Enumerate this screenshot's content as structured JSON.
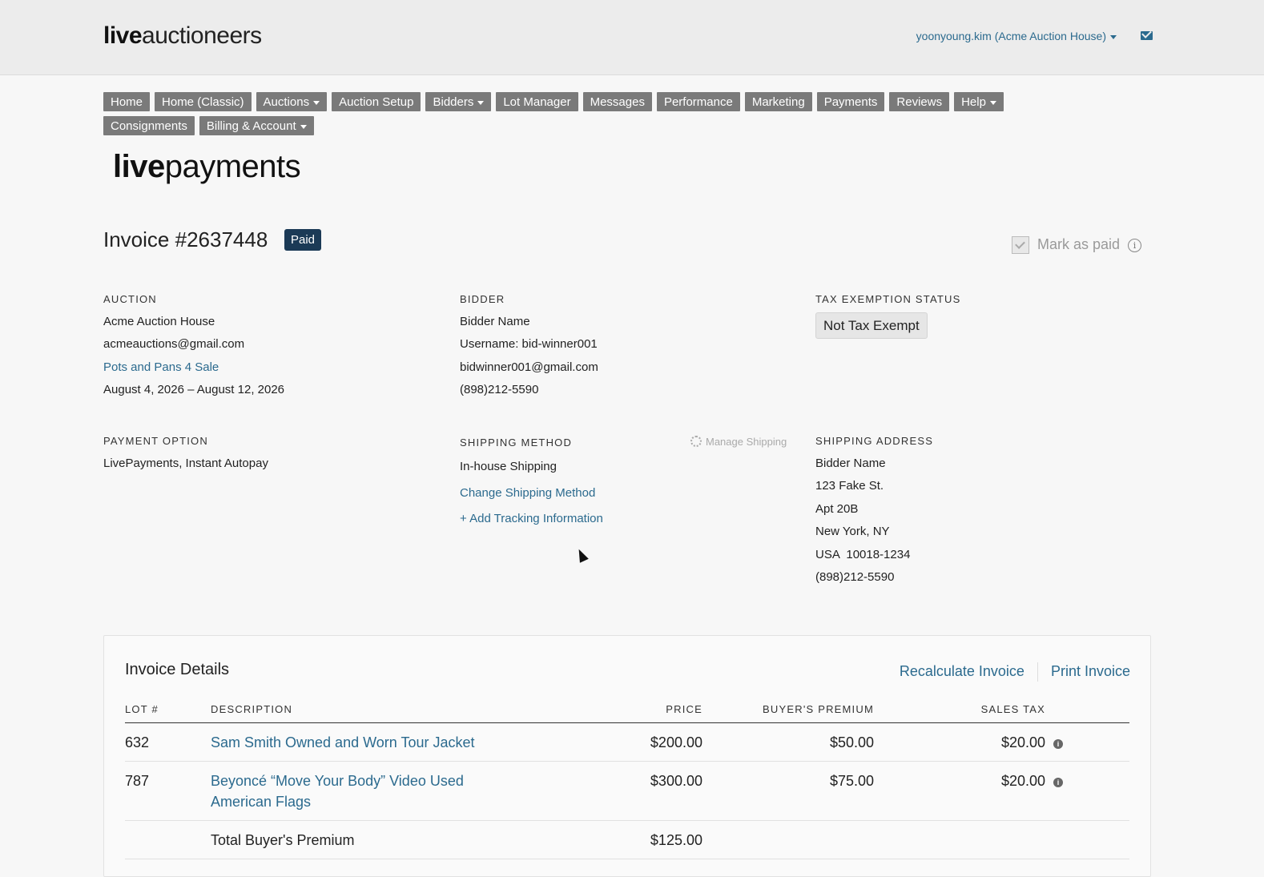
{
  "header": {
    "logo_bold": "live",
    "logo_light": "auctioneers",
    "user_label": "yoonyoung.kim (Acme Auction House)",
    "mail_icon": "envelope-icon"
  },
  "nav": {
    "row1": [
      "Home",
      "Home (Classic)",
      "Auctions",
      "Auction Setup",
      "Bidders",
      "Lot Manager",
      "Messages",
      "Performance",
      "Marketing",
      "Payments",
      "Reviews",
      "Help"
    ],
    "row2": [
      "Consignments",
      "Billing & Account"
    ],
    "dropdowns": [
      "Auctions",
      "Bidders",
      "Help",
      "Billing & Account"
    ]
  },
  "brand": {
    "bold": "live",
    "light": "payments"
  },
  "invoice": {
    "title": "Invoice #2637448",
    "status_badge": "Paid",
    "mark_as_paid": "Mark as paid"
  },
  "auction": {
    "label": "AUCTION",
    "house": "Acme Auction House",
    "email": "acmeauctions@gmail.com",
    "auction_link": "Pots and Pans 4 Sale",
    "dates": "August 4, 2026 – August 12, 2026"
  },
  "bidder": {
    "label": "BIDDER",
    "name": "Bidder Name",
    "username": "Username: bid-winner001",
    "email": "bidwinner001@gmail.com",
    "phone": "(898)212-5590"
  },
  "tax": {
    "label": "TAX EXEMPTION STATUS",
    "status": "Not Tax Exempt"
  },
  "payment": {
    "label": "PAYMENT OPTION",
    "value": "LivePayments, Instant Autopay"
  },
  "shipping_method": {
    "label": "SHIPPING METHOD",
    "manage": "Manage Shipping",
    "value": "In-house Shipping",
    "change_link": "Change Shipping Method",
    "add_tracking": "+ Add Tracking Information"
  },
  "shipping_address": {
    "label": "SHIPPING ADDRESS",
    "name": "Bidder Name",
    "street": "123 Fake St.",
    "apt": "Apt 20B",
    "city": "New York, NY",
    "country_zip": "USA  10018-1234",
    "phone": "(898)212-5590"
  },
  "details": {
    "title": "Invoice Details",
    "recalculate": "Recalculate Invoice",
    "print": "Print Invoice",
    "columns": {
      "lot": "LOT #",
      "description": "DESCRIPTION",
      "price": "PRICE",
      "premium": "BUYER'S PREMIUM",
      "tax": "SALES TAX"
    },
    "rows": [
      {
        "lot": "632",
        "description": "Sam Smith Owned and Worn Tour Jacket",
        "price": "$200.00",
        "premium": "$50.00",
        "tax": "$20.00"
      },
      {
        "lot": "787",
        "description_line1": "Beyoncé “Move Your Body” Video Used",
        "description_line2": "American Flags",
        "price": "$300.00",
        "premium": "$75.00",
        "tax": "$20.00"
      }
    ],
    "total_premium_label": "Total Buyer's Premium",
    "total_premium_value": "$125.00"
  }
}
